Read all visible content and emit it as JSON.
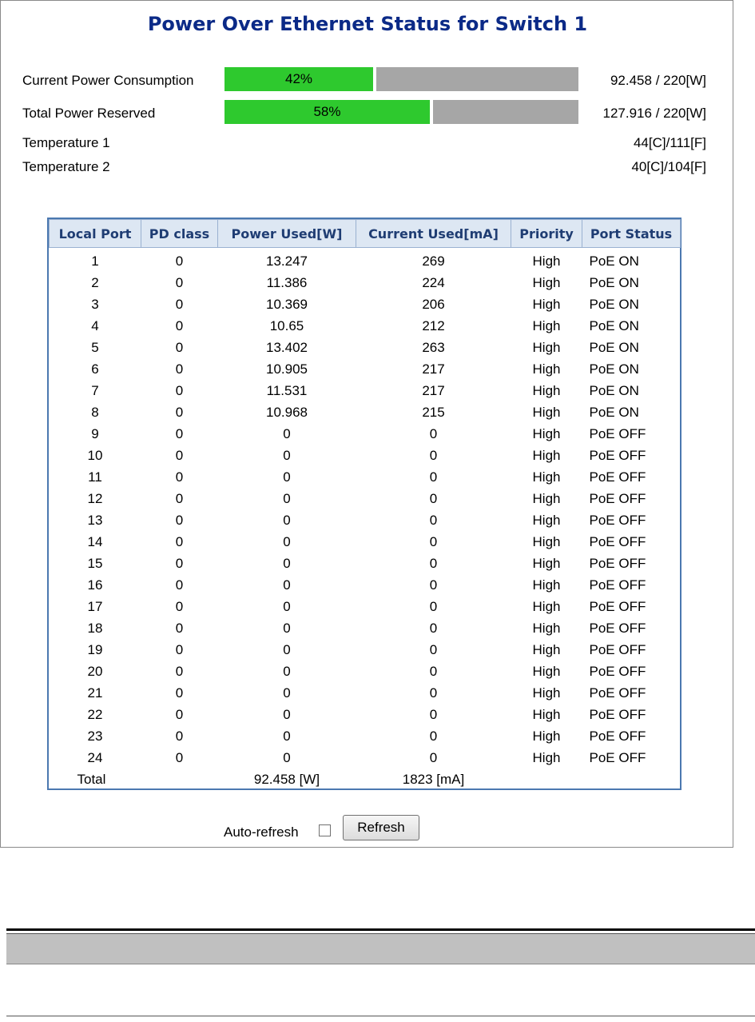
{
  "title": "Power Over Ethernet Status for Switch 1",
  "summary": {
    "current_power": {
      "label": "Current Power Consumption",
      "percent_text": "42%",
      "percent": 42,
      "value": "92.458 / 220[W]"
    },
    "total_reserved": {
      "label": "Total Power Reserved",
      "percent_text": "58%",
      "percent": 58,
      "value": "127.916 / 220[W]"
    },
    "temp1": {
      "label": "Temperature 1",
      "value": "44[C]/111[F]"
    },
    "temp2": {
      "label": "Temperature 2",
      "value": "40[C]/104[F]"
    }
  },
  "table": {
    "headers": [
      "Local Port",
      "PD class",
      "Power Used[W]",
      "Current Used[mA]",
      "Priority",
      "Port Status"
    ],
    "rows": [
      [
        "1",
        "0",
        "13.247",
        "269",
        "High",
        "PoE ON"
      ],
      [
        "2",
        "0",
        "11.386",
        "224",
        "High",
        "PoE ON"
      ],
      [
        "3",
        "0",
        "10.369",
        "206",
        "High",
        "PoE ON"
      ],
      [
        "4",
        "0",
        "10.65",
        "212",
        "High",
        "PoE ON"
      ],
      [
        "5",
        "0",
        "13.402",
        "263",
        "High",
        "PoE ON"
      ],
      [
        "6",
        "0",
        "10.905",
        "217",
        "High",
        "PoE ON"
      ],
      [
        "7",
        "0",
        "11.531",
        "217",
        "High",
        "PoE ON"
      ],
      [
        "8",
        "0",
        "10.968",
        "215",
        "High",
        "PoE ON"
      ],
      [
        "9",
        "0",
        "0",
        "0",
        "High",
        "PoE OFF"
      ],
      [
        "10",
        "0",
        "0",
        "0",
        "High",
        "PoE OFF"
      ],
      [
        "11",
        "0",
        "0",
        "0",
        "High",
        "PoE OFF"
      ],
      [
        "12",
        "0",
        "0",
        "0",
        "High",
        "PoE OFF"
      ],
      [
        "13",
        "0",
        "0",
        "0",
        "High",
        "PoE OFF"
      ],
      [
        "14",
        "0",
        "0",
        "0",
        "High",
        "PoE OFF"
      ],
      [
        "15",
        "0",
        "0",
        "0",
        "High",
        "PoE OFF"
      ],
      [
        "16",
        "0",
        "0",
        "0",
        "High",
        "PoE OFF"
      ],
      [
        "17",
        "0",
        "0",
        "0",
        "High",
        "PoE OFF"
      ],
      [
        "18",
        "0",
        "0",
        "0",
        "High",
        "PoE OFF"
      ],
      [
        "19",
        "0",
        "0",
        "0",
        "High",
        "PoE OFF"
      ],
      [
        "20",
        "0",
        "0",
        "0",
        "High",
        "PoE OFF"
      ],
      [
        "21",
        "0",
        "0",
        "0",
        "High",
        "PoE OFF"
      ],
      [
        "22",
        "0",
        "0",
        "0",
        "High",
        "PoE OFF"
      ],
      [
        "23",
        "0",
        "0",
        "0",
        "High",
        "PoE OFF"
      ],
      [
        "24",
        "0",
        "0",
        "0",
        "High",
        "PoE OFF"
      ]
    ],
    "total": {
      "label": "Total",
      "power": "92.458 [W]",
      "current": "1823 [mA]"
    }
  },
  "controls": {
    "auto_refresh_label": "Auto-refresh",
    "auto_refresh_checked": false,
    "refresh_label": "Refresh"
  },
  "colors": {
    "title": "#0b2a87",
    "bar_fill": "#2ec92e",
    "bar_track": "#a6a6a6",
    "table_border": "#4b78b0",
    "header_bg": "#dde7f3"
  }
}
